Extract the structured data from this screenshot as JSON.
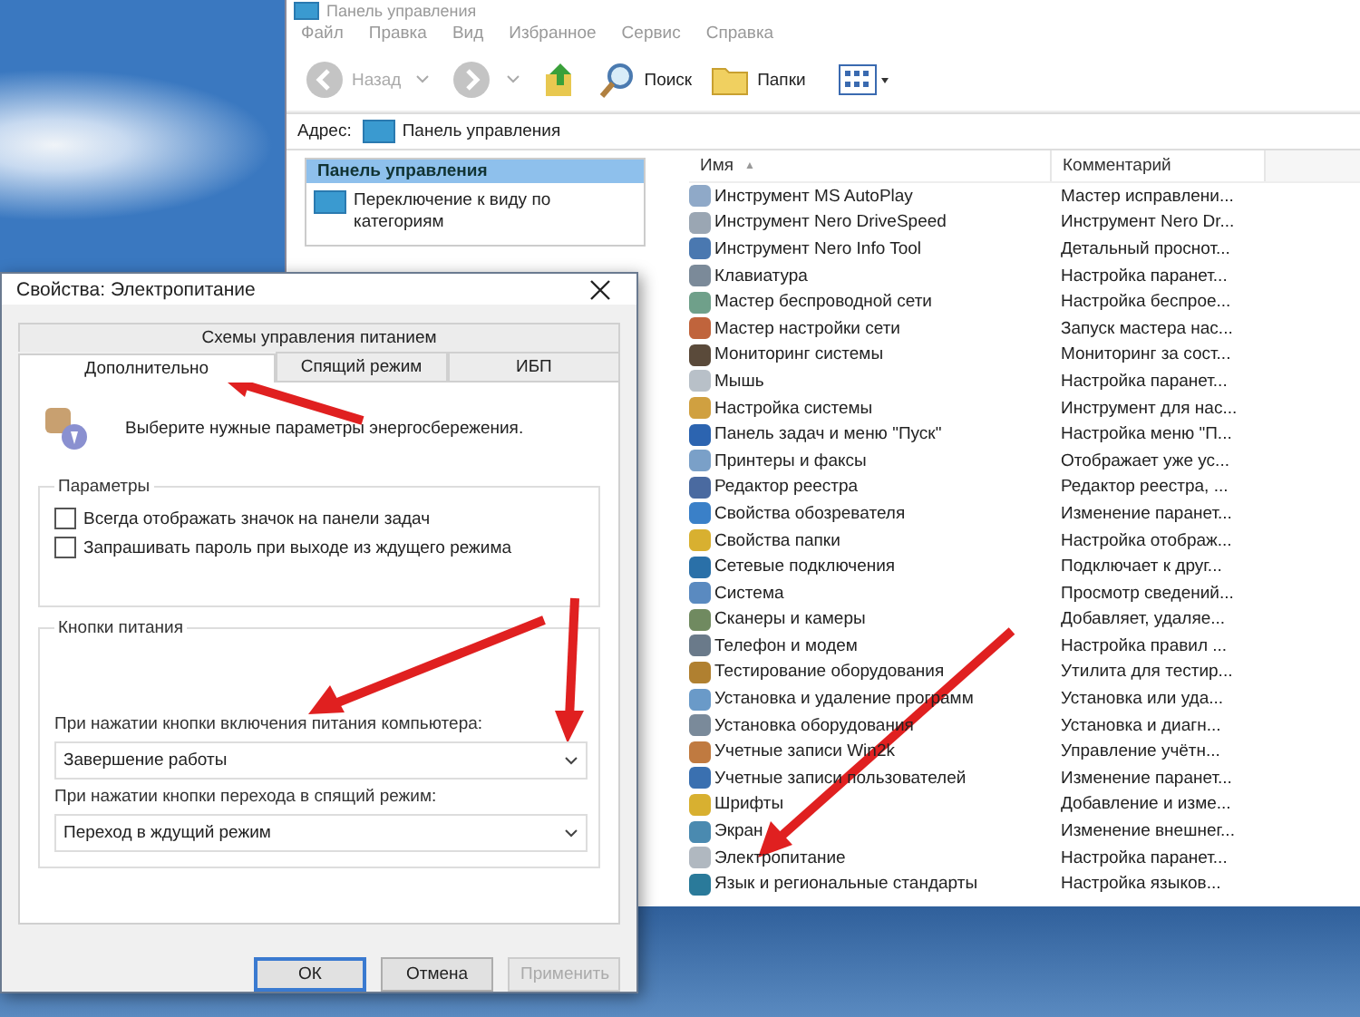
{
  "explorer": {
    "title": "Панель управления",
    "menu": [
      "Файл",
      "Правка",
      "Вид",
      "Избранное",
      "Сервис",
      "Справка"
    ],
    "toolbar": [
      {
        "kind": "back",
        "label": "Назад",
        "disabled": true
      },
      {
        "kind": "forward",
        "disabled": true
      },
      {
        "kind": "up"
      },
      {
        "kind": "search",
        "label": "Поиск"
      },
      {
        "kind": "folders",
        "label": "Папки"
      },
      {
        "kind": "views"
      }
    ],
    "address": {
      "label": "Адрес:",
      "value": "Панель управления"
    },
    "task_pane": {
      "title": "Панель управления",
      "link": "Переключение к виду по категориям"
    },
    "columns": [
      {
        "label": "Имя",
        "sort": "▲"
      },
      {
        "label": "Комментарий"
      }
    ],
    "rows": [
      {
        "name": "Инструмент MS AutoPlay",
        "comment": "Мастер исправлени...",
        "color": "#8fa9c8"
      },
      {
        "name": "Инструмент Nero DriveSpeed",
        "comment": "Инструмент Nero Dr...",
        "color": "#9aa6b3"
      },
      {
        "name": "Инструмент Nero Info Tool",
        "comment": "Детальный проснот...",
        "color": "#4a78b0"
      },
      {
        "name": "Клавиатура",
        "comment": "Настройка паранет...",
        "color": "#7b8a99"
      },
      {
        "name": "Мастер беспроводной сети",
        "comment": "Настройка беспрое...",
        "color": "#6fa08a"
      },
      {
        "name": "Мастер настройки сети",
        "comment": "Запуск мастера нас...",
        "color": "#c0643c"
      },
      {
        "name": "Мониторинг системы",
        "comment": "Мониторинг за сост...",
        "color": "#5a4a3a"
      },
      {
        "name": "Мышь",
        "comment": "Настройка паранет...",
        "color": "#b8c0c8"
      },
      {
        "name": "Настройка системы",
        "comment": "Инструмент для нас...",
        "color": "#d0a040"
      },
      {
        "name": "Панель задач и меню \"Пуск\"",
        "comment": "Настройка меню \"П...",
        "color": "#2c64b0"
      },
      {
        "name": "Принтеры и факсы",
        "comment": "Отображает уже ус...",
        "color": "#7aa0c8"
      },
      {
        "name": "Редактор реестра",
        "comment": "Редактор реестра, ...",
        "color": "#4a6aa0"
      },
      {
        "name": "Свойства обозревателя",
        "comment": "Изменение паранет...",
        "color": "#3a80c8"
      },
      {
        "name": "Свойства папки",
        "comment": "Настройка отображ...",
        "color": "#d8b030"
      },
      {
        "name": "Сетевые подключения",
        "comment": "Подключает к друг...",
        "color": "#2a70a8"
      },
      {
        "name": "Система",
        "comment": "Просмотр сведений...",
        "color": "#5a8ac0"
      },
      {
        "name": "Сканеры и камеры",
        "comment": "Добавляет, удаляе...",
        "color": "#708a60"
      },
      {
        "name": "Телефон и модем",
        "comment": "Настройка правил ...",
        "color": "#6a7a8a"
      },
      {
        "name": "Тестирование оборудования",
        "comment": "Утилита для тестир...",
        "color": "#b08030"
      },
      {
        "name": "Установка и удаление программ",
        "comment": "Установка или уда...",
        "color": "#6a9ac8"
      },
      {
        "name": "Установка оборудования",
        "comment": "Установка и диагн...",
        "color": "#7a8a9a"
      },
      {
        "name": "Учетные записи Win2k",
        "comment": "Управление учётн...",
        "color": "#c07a40"
      },
      {
        "name": "Учетные записи пользователей",
        "comment": "Изменение паранет...",
        "color": "#3a70b0"
      },
      {
        "name": "Шрифты",
        "comment": "Добавление и изме...",
        "color": "#d8b030"
      },
      {
        "name": "Экран",
        "comment": "Изменение внешнег...",
        "color": "#4a8ab0"
      },
      {
        "name": "Электропитание",
        "comment": "Настройка паранет...",
        "color": "#b0b8c0"
      },
      {
        "name": "Язык и региональные стандарты",
        "comment": "Настройка языков...",
        "color": "#2a7a9a"
      }
    ]
  },
  "dialog": {
    "title": "Свойства: Электропитание",
    "tab_rows": [
      [
        {
          "label": "Схемы управления питанием",
          "selected": false
        }
      ],
      [
        {
          "label": "Дополнительно",
          "selected": true
        },
        {
          "label": "Спящий режим",
          "selected": false
        },
        {
          "label": "ИБП",
          "selected": false
        }
      ]
    ],
    "intro": "Выберите нужные параметры энергосбережения.",
    "options_group": {
      "title": "Параметры",
      "checkboxes": [
        {
          "label": "Всегда отображать значок на панели задач",
          "checked": false
        },
        {
          "label": "Запрашивать пароль при выходе из ждущего режима",
          "checked": false
        }
      ]
    },
    "buttons_group": {
      "title": "Кнопки питания",
      "selects": [
        {
          "label": "При нажатии кнопки включения питания компьютера:",
          "value": "Завершение работы"
        },
        {
          "label": "При нажатии кнопки перехода в спящий режим:",
          "value": "Переход в ждущий режим"
        }
      ]
    },
    "buttons": [
      {
        "label": "ОК",
        "default": true,
        "disabled": false
      },
      {
        "label": "Отмена",
        "default": false,
        "disabled": false
      },
      {
        "label": "Применить",
        "default": false,
        "disabled": true
      }
    ]
  }
}
